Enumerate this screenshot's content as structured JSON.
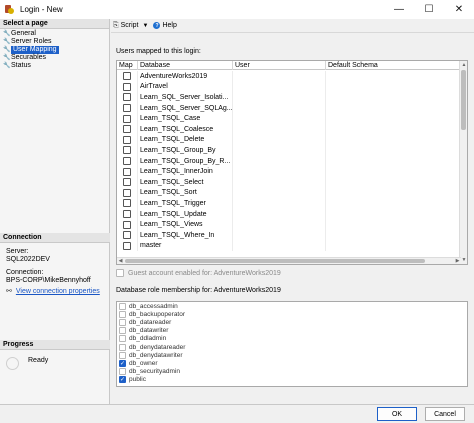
{
  "window": {
    "title": "Login - New",
    "minimize": "—",
    "maximize": "☐",
    "close": "✕"
  },
  "left": {
    "select_page_header": "Select a page",
    "pages": [
      {
        "label": "General",
        "selected": false
      },
      {
        "label": "Server Roles",
        "selected": false
      },
      {
        "label": "User Mapping",
        "selected": true
      },
      {
        "label": "Securables",
        "selected": false
      },
      {
        "label": "Status",
        "selected": false
      }
    ],
    "connection_header": "Connection",
    "server_label": "Server:",
    "server_value": "SQL2022DEV",
    "connection_label": "Connection:",
    "connection_value": "BPS-CORP\\MikeBennyhoff",
    "view_connection_link": "View connection properties",
    "progress_header": "Progress",
    "progress_status": "Ready"
  },
  "toolbar": {
    "script_label": "Script",
    "help_label": "Help"
  },
  "users_mapped": {
    "label": "Users mapped to this login:",
    "columns": {
      "map": "Map",
      "database": "Database",
      "user": "User",
      "schema": "Default Schema"
    },
    "rows": [
      {
        "database": "AdventureWorks2019",
        "mapped": false
      },
      {
        "database": "AirTravel",
        "mapped": false
      },
      {
        "database": "Learn_SQL_Server_Isolati...",
        "mapped": false
      },
      {
        "database": "Learn_SQL_Server_SQLAg...",
        "mapped": false
      },
      {
        "database": "Learn_TSQL_Case",
        "mapped": false
      },
      {
        "database": "Learn_TSQL_Coalesce",
        "mapped": false
      },
      {
        "database": "Learn_TSQL_Delete",
        "mapped": false
      },
      {
        "database": "Learn_TSQL_Group_By",
        "mapped": false
      },
      {
        "database": "Learn_TSQL_Group_By_R...",
        "mapped": false
      },
      {
        "database": "Learn_TSQL_InnerJoin",
        "mapped": false
      },
      {
        "database": "Learn_TSQL_Select",
        "mapped": false
      },
      {
        "database": "Learn_TSQL_Sort",
        "mapped": false
      },
      {
        "database": "Learn_TSQL_Trigger",
        "mapped": false
      },
      {
        "database": "Learn_TSQL_Update",
        "mapped": false
      },
      {
        "database": "Learn_TSQL_Views",
        "mapped": false
      },
      {
        "database": "Learn_TSQL_Where_In",
        "mapped": false
      },
      {
        "database": "master",
        "mapped": false
      }
    ]
  },
  "guest_label": "Guest account enabled for: AdventureWorks2019",
  "roles": {
    "label": "Database role membership for: AdventureWorks2019",
    "items": [
      {
        "name": "db_accessadmin",
        "checked": false
      },
      {
        "name": "db_backupoperator",
        "checked": false
      },
      {
        "name": "db_datareader",
        "checked": false
      },
      {
        "name": "db_datawriter",
        "checked": false
      },
      {
        "name": "db_ddladmin",
        "checked": false
      },
      {
        "name": "db_denydatareader",
        "checked": false
      },
      {
        "name": "db_denydatawriter",
        "checked": false
      },
      {
        "name": "db_owner",
        "checked": true
      },
      {
        "name": "db_securityadmin",
        "checked": false
      },
      {
        "name": "public",
        "checked": true
      }
    ]
  },
  "buttons": {
    "ok": "OK",
    "cancel": "Cancel"
  },
  "colors": {
    "accent": "#1e60c8",
    "link": "#1a56c4"
  },
  "icons": {
    "page": "wrench-icon",
    "script": "script-icon",
    "help": "help-icon",
    "connection": "network-icon"
  }
}
